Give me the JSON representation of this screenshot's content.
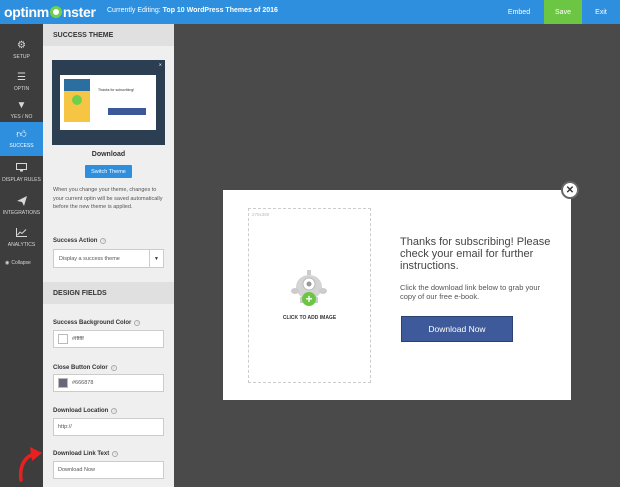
{
  "topbar": {
    "logo": "optinmonster",
    "logo_pre": "optinm",
    "logo_post": "nster",
    "editing_label": "Currently Editing:",
    "editing_title": "Top 10 WordPress Themes of 2016",
    "embed": "Embed",
    "save": "Save",
    "exit": "Exit"
  },
  "nav": {
    "items": [
      {
        "label": "SETUP",
        "icon": "gear-icon"
      },
      {
        "label": "OPTIN",
        "icon": "list-icon"
      },
      {
        "label": "YES / NO",
        "icon": "filter-icon"
      },
      {
        "label": "SUCCESS",
        "icon": "thumbs-up-icon"
      },
      {
        "label": "DISPLAY RULES",
        "icon": "monitor-icon"
      },
      {
        "label": "INTEGRATIONS",
        "icon": "paper-plane-icon"
      },
      {
        "label": "ANALYTICS",
        "icon": "chart-icon"
      }
    ],
    "collapse": "Collapse"
  },
  "sidebar": {
    "success_theme_heading": "SUCCESS THEME",
    "preview": {
      "book_title": "DOUBLE YOUR\nCONVERSIONS",
      "thanks": "Thanks for subscribing!"
    },
    "theme_name": "Download",
    "switch_button": "Switch Theme",
    "note": "When you change your theme, changes to your current optin will be saved automatically before the new theme is applied.",
    "success_action_label": "Success Action",
    "success_action_value": "Display a success theme",
    "design_fields_heading": "DESIGN FIELDS",
    "bg_color_label": "Success Background Color",
    "bg_color_value": "#ffffff",
    "close_color_label": "Close Button Color",
    "close_color_value": "#666878",
    "download_location_label": "Download Location",
    "download_location_value": "http://",
    "download_text_label": "Download Link Text",
    "download_text_value": "Download Now"
  },
  "popup": {
    "dims": "275x380",
    "click_to_add": "CLICK TO ADD IMAGE",
    "title": "Thanks for subscribing! Please check your email for further instructions.",
    "body": "Click the download link below to grab your copy of our free e-book.",
    "button": "Download Now"
  },
  "colors": {
    "accent": "#2d8fdd",
    "save": "#6cc644",
    "popup_button": "#3e5a9a",
    "nav_bg": "#3d3d3d"
  }
}
